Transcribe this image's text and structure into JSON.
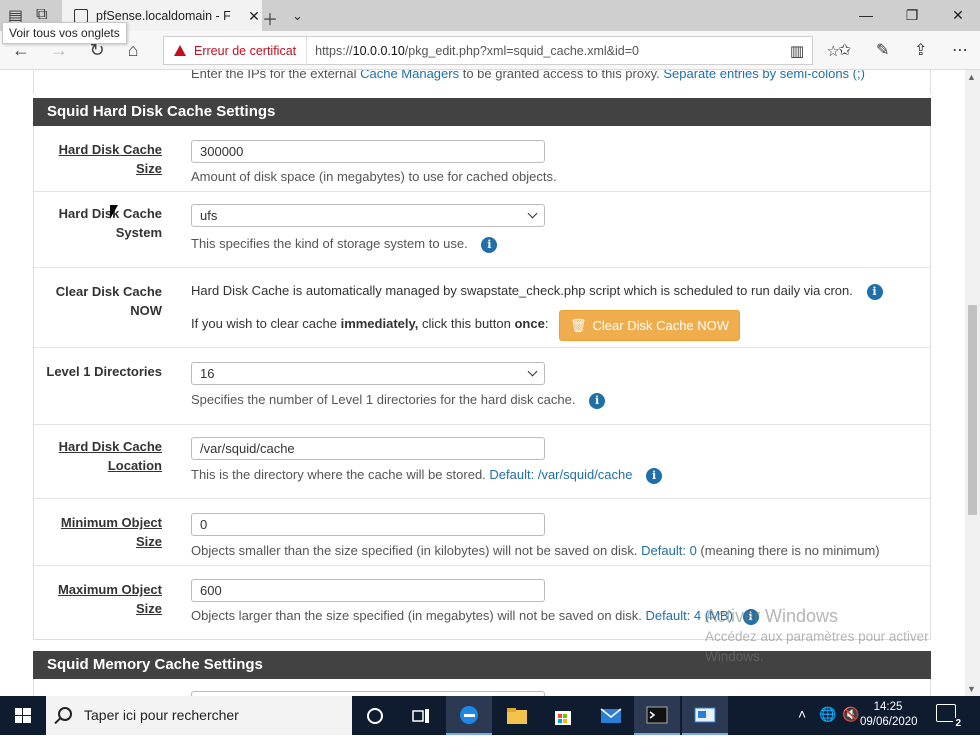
{
  "browser": {
    "tab_title": "pfSense.localdomain - F",
    "tooltip": "Voir tous vos onglets",
    "cert_warning": "Erreur de certificat",
    "url_prefix": "https://",
    "url_host": "10.0.0.10",
    "url_path": "/pkg_edit.php?xml=squid_cache.xml&id=0"
  },
  "page": {
    "top_partial_help_prefix": "Enter the IPs for the external ",
    "top_partial_help_link": "Cache Managers",
    "top_partial_help_mid": " to be granted access to this proxy. ",
    "top_partial_help_def": "Separate entries by semi-colons (;)",
    "section_hdd": "Squid Hard Disk Cache Settings",
    "section_mem": "Squid Memory Cache Settings",
    "rows": {
      "hdd_size": {
        "label_line1": "Hard Disk Cache",
        "label_line2": "Size",
        "value": "300000",
        "help": "Amount of disk space (in megabytes) to use for cached objects."
      },
      "hdd_system": {
        "label_line1": "Hard Disk Cache",
        "label_line2": "System",
        "value": "ufs",
        "help": "This specifies the kind of storage system to use."
      },
      "clear_cache": {
        "label_line1": "Clear Disk Cache",
        "label_line2": "NOW",
        "help_line1": "Hard Disk Cache is automatically managed by swapstate_check.php script which is scheduled to run daily via cron.",
        "help_line2_a": "If you wish to clear cache ",
        "help_line2_b": "immediately,",
        "help_line2_c": " click this button ",
        "help_line2_d": "once",
        "help_line2_e": ":",
        "button_label": "Clear Disk Cache NOW"
      },
      "level1": {
        "label_line1": "Level 1 Directories",
        "value": "16",
        "help": "Specifies the number of Level 1 directories for the hard disk cache."
      },
      "location": {
        "label_line1": "Hard Disk Cache",
        "label_line2": "Location",
        "value": "/var/squid/cache",
        "help": "This is the directory where the cache will be stored. ",
        "help_default": "Default: /var/squid/cache"
      },
      "min_obj": {
        "label_line1": "Minimum Object",
        "label_line2": "Size",
        "value": "0",
        "help": "Objects smaller than the size specified (in kilobytes) will not be saved on disk. ",
        "help_default": "Default: 0",
        "help_tail": " (meaning there is no minimum)"
      },
      "max_obj": {
        "label_line1": "Maximum Object",
        "label_line2": "Size",
        "value": "600",
        "help": "Objects larger than the size specified (in megabytes) will not be saved on disk. ",
        "help_default": "Default: 4 (MB)"
      }
    }
  },
  "watermark": {
    "line1": "Activer Windows",
    "line2": "Accédez aux paramètres pour activer",
    "line3": "Windows."
  },
  "taskbar": {
    "search_placeholder": "Taper ici pour rechercher",
    "time": "14:25",
    "date": "09/06/2020",
    "notifications": "2"
  }
}
